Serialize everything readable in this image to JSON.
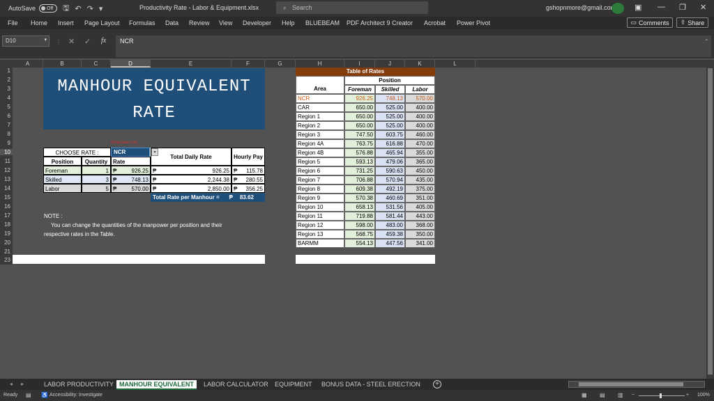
{
  "titlebar": {
    "autosave_label": "AutoSave",
    "autosave_state": "Off",
    "file_title": "Productivity Rate - Labor & Equipment.xlsx",
    "search_placeholder": "Search",
    "email": "gshopnmore@gmail.com"
  },
  "menu": [
    "File",
    "Home",
    "Insert",
    "Page Layout",
    "Formulas",
    "Data",
    "Review",
    "View",
    "Developer",
    "Help",
    "BLUEBEAM",
    "PDF Architect 9 Creator",
    "Acrobat",
    "Power Pivot"
  ],
  "buttons": {
    "comments": "Comments",
    "share": "Share"
  },
  "formula_bar": {
    "name_box": "D10",
    "fx": "fx",
    "value": "NCR"
  },
  "columns": [
    "A",
    "B",
    "C",
    "D",
    "E",
    "F",
    "G",
    "H",
    "I",
    "J",
    "K",
    "L"
  ],
  "rows": [
    "1",
    "2",
    "3",
    "4",
    "5",
    "6",
    "7",
    "8",
    "9",
    "10",
    "11",
    "12",
    "13",
    "14",
    "15",
    "16",
    "17",
    "18",
    "19",
    "20",
    "21",
    "23"
  ],
  "banner": {
    "line1": "MANHOUR EQUIVALENT",
    "line2": "RATE"
  },
  "calculator": {
    "dropdown_hint": "(Drop-Down List)",
    "choose_label": "CHOOSE RATE :",
    "choose_value": "NCR",
    "headers": {
      "position": "Position",
      "quantity": "Quantity",
      "rate": "Rate",
      "total_daily": "Total Daily Rate",
      "hourly": "Hourly Pay"
    },
    "currency": "₱",
    "rows": [
      {
        "position": "Foreman",
        "quantity": "1",
        "rate": "926.25",
        "total": "926.25",
        "hourly": "115.78"
      },
      {
        "position": "Skilled",
        "quantity": "3",
        "rate": "748.13",
        "total": "2,244.38",
        "hourly": "280.55"
      },
      {
        "position": "Labor",
        "quantity": "5",
        "rate": "570.00",
        "total": "2,850.00",
        "hourly": "356.25"
      }
    ],
    "total_label": "Total Rate per Manhour =",
    "total_value": "83.62"
  },
  "note": {
    "title": "NOTE :",
    "line1": "You can change the quantities of the manpower per position and their",
    "line2": "respective rates in the Table."
  },
  "rates_table": {
    "title": "Table of Rates",
    "position_header": "Position",
    "area_header": "Area",
    "col_headers": [
      "Foreman",
      "Skilled",
      "Labor"
    ],
    "rows": [
      {
        "area": "NCR",
        "foreman": "926.25",
        "skilled": "748.13",
        "labor": "570.00"
      },
      {
        "area": "CAR",
        "foreman": "650.00",
        "skilled": "525.00",
        "labor": "400.00"
      },
      {
        "area": "Region 1",
        "foreman": "650.00",
        "skilled": "525.00",
        "labor": "400.00"
      },
      {
        "area": "Region 2",
        "foreman": "650.00",
        "skilled": "525.00",
        "labor": "400.00"
      },
      {
        "area": "Region 3",
        "foreman": "747.50",
        "skilled": "603.75",
        "labor": "460.00"
      },
      {
        "area": "Region 4A",
        "foreman": "763.75",
        "skilled": "616.88",
        "labor": "470.00"
      },
      {
        "area": "Region 4B",
        "foreman": "576.88",
        "skilled": "465.94",
        "labor": "355.00"
      },
      {
        "area": "Region 5",
        "foreman": "593.13",
        "skilled": "479.06",
        "labor": "365.00"
      },
      {
        "area": "Region 6",
        "foreman": "731.25",
        "skilled": "590.63",
        "labor": "450.00"
      },
      {
        "area": "Region 7",
        "foreman": "706.88",
        "skilled": "570.94",
        "labor": "435.00"
      },
      {
        "area": "Region 8",
        "foreman": "609.38",
        "skilled": "492.19",
        "labor": "375.00"
      },
      {
        "area": "Region 9",
        "foreman": "570.38",
        "skilled": "460.69",
        "labor": "351.00"
      },
      {
        "area": "Region 10",
        "foreman": "658.13",
        "skilled": "531.56",
        "labor": "405.00"
      },
      {
        "area": "Region 11",
        "foreman": "719.88",
        "skilled": "581.44",
        "labor": "443.00"
      },
      {
        "area": "Region 12",
        "foreman": "598.00",
        "skilled": "483.00",
        "labor": "368.00"
      },
      {
        "area": "Region 13",
        "foreman": "568.75",
        "skilled": "459.38",
        "labor": "350.00"
      },
      {
        "area": "BARMM",
        "foreman": "554.13",
        "skilled": "447.56",
        "labor": "341.00"
      }
    ]
  },
  "sheets": [
    {
      "label": "LABOR PRODUCTIVITY",
      "active": false
    },
    {
      "label": "MANHOUR EQUIVALENT",
      "active": true
    },
    {
      "label": "LABOR CALCULATOR",
      "active": false
    },
    {
      "label": "EQUIPMENT",
      "active": false
    },
    {
      "label": "BONUS DATA - STEEL ERECTION",
      "active": false
    }
  ],
  "status": {
    "ready": "Ready",
    "accessibility": "Accessibility: Investigate",
    "zoom": "100%"
  },
  "colors": {
    "banner_blue": "#1f4e79",
    "rates_title_brown": "#843c0c",
    "foreman_fill": "#e2efda",
    "skilled_fill": "#d9e1f2",
    "labor_fill": "#d9d9d9",
    "ncr_text": "#c55a11",
    "excel_green": "#1e6b3a"
  }
}
